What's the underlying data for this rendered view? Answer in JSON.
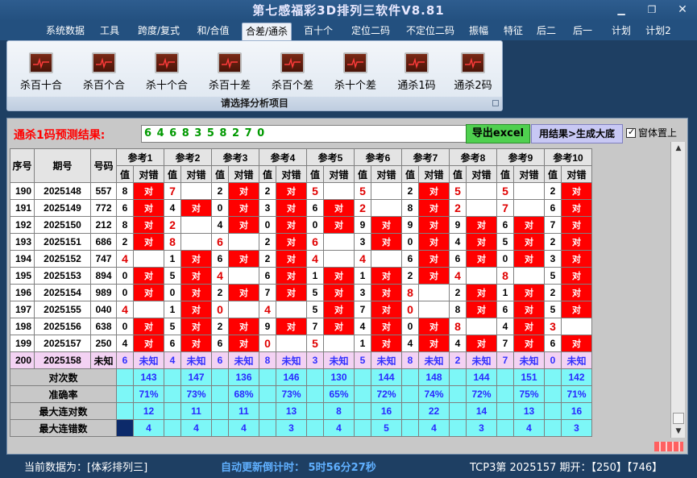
{
  "window": {
    "title": "第七感福彩3D排列三软件V8.81"
  },
  "menu": [
    "系统数据",
    "工具",
    "跨度/复式",
    "和/合值",
    "合差/通杀",
    "百十个",
    "定位二码",
    "不定位二码",
    "振幅",
    "特征",
    "后二",
    "后一",
    "计划",
    "计划2"
  ],
  "active_menu": "合差/通杀",
  "ribbon": {
    "buttons": [
      "杀百十合",
      "杀百个合",
      "杀十个合",
      "杀百十差",
      "杀百个差",
      "杀十个差",
      "通杀1码",
      "通杀2码"
    ],
    "group_label": "请选择分析项目"
  },
  "prediction": {
    "label": "通杀1码预测结果:",
    "value": "6 4 6 8 3 5 8 2 7 0",
    "export_button": "导出excel",
    "generate_button": "用结果>生成大底",
    "ontop_label": "窗体置上"
  },
  "table": {
    "headers": {
      "seq": "序号",
      "issue": "期号",
      "number": "号码",
      "value": "值",
      "hit": "对错"
    },
    "refs": [
      "参考1",
      "参考2",
      "参考3",
      "参考4",
      "参考5",
      "参考6",
      "参考7",
      "参考8",
      "参考9",
      "参考10"
    ],
    "hit_text": "对",
    "rows": [
      {
        "seq": "190",
        "issue": "2025148",
        "num": "557",
        "cells": [
          [
            "8",
            true
          ],
          [
            "7",
            false
          ],
          [
            "2",
            true
          ],
          [
            "2",
            true
          ],
          [
            "5",
            false
          ],
          [
            "5",
            false
          ],
          [
            "2",
            true
          ],
          [
            "5",
            false
          ],
          [
            "5",
            false
          ],
          [
            "2",
            true
          ]
        ]
      },
      {
        "seq": "191",
        "issue": "2025149",
        "num": "772",
        "cells": [
          [
            "6",
            true
          ],
          [
            "4",
            true
          ],
          [
            "0",
            true
          ],
          [
            "3",
            true
          ],
          [
            "6",
            true
          ],
          [
            "2",
            false
          ],
          [
            "8",
            true
          ],
          [
            "2",
            false
          ],
          [
            "7",
            false
          ],
          [
            "6",
            true
          ]
        ]
      },
      {
        "seq": "192",
        "issue": "2025150",
        "num": "212",
        "cells": [
          [
            "8",
            true
          ],
          [
            "2",
            false
          ],
          [
            "4",
            true
          ],
          [
            "0",
            true
          ],
          [
            "0",
            true
          ],
          [
            "9",
            true
          ],
          [
            "9",
            true
          ],
          [
            "9",
            true
          ],
          [
            "6",
            true
          ],
          [
            "7",
            true
          ]
        ]
      },
      {
        "seq": "193",
        "issue": "2025151",
        "num": "686",
        "cells": [
          [
            "2",
            true
          ],
          [
            "8",
            false
          ],
          [
            "6",
            false
          ],
          [
            "2",
            true
          ],
          [
            "6",
            false
          ],
          [
            "3",
            true
          ],
          [
            "0",
            true
          ],
          [
            "4",
            true
          ],
          [
            "5",
            true
          ],
          [
            "2",
            true
          ]
        ]
      },
      {
        "seq": "194",
        "issue": "2025152",
        "num": "747",
        "cells": [
          [
            "4",
            false
          ],
          [
            "1",
            true
          ],
          [
            "6",
            true
          ],
          [
            "2",
            true
          ],
          [
            "4",
            false
          ],
          [
            "4",
            false
          ],
          [
            "6",
            true
          ],
          [
            "6",
            true
          ],
          [
            "0",
            true
          ],
          [
            "3",
            true
          ]
        ]
      },
      {
        "seq": "195",
        "issue": "2025153",
        "num": "894",
        "cells": [
          [
            "0",
            true
          ],
          [
            "5",
            true
          ],
          [
            "4",
            false
          ],
          [
            "6",
            true
          ],
          [
            "1",
            true
          ],
          [
            "1",
            true
          ],
          [
            "2",
            true
          ],
          [
            "4",
            false
          ],
          [
            "8",
            false
          ],
          [
            "5",
            true
          ]
        ]
      },
      {
        "seq": "196",
        "issue": "2025154",
        "num": "989",
        "cells": [
          [
            "0",
            true
          ],
          [
            "0",
            true
          ],
          [
            "2",
            true
          ],
          [
            "7",
            true
          ],
          [
            "5",
            true
          ],
          [
            "3",
            true
          ],
          [
            "8",
            false
          ],
          [
            "2",
            true
          ],
          [
            "1",
            true
          ],
          [
            "2",
            true
          ]
        ]
      },
      {
        "seq": "197",
        "issue": "2025155",
        "num": "040",
        "cells": [
          [
            "4",
            false
          ],
          [
            "1",
            true
          ],
          [
            "0",
            false
          ],
          [
            "4",
            false
          ],
          [
            "5",
            true
          ],
          [
            "7",
            true
          ],
          [
            "0",
            false
          ],
          [
            "8",
            true
          ],
          [
            "6",
            true
          ],
          [
            "5",
            true
          ]
        ]
      },
      {
        "seq": "198",
        "issue": "2025156",
        "num": "638",
        "cells": [
          [
            "0",
            true
          ],
          [
            "5",
            true
          ],
          [
            "2",
            true
          ],
          [
            "9",
            true
          ],
          [
            "7",
            true
          ],
          [
            "4",
            true
          ],
          [
            "0",
            true
          ],
          [
            "8",
            false
          ],
          [
            "4",
            true
          ],
          [
            "3",
            false
          ]
        ]
      },
      {
        "seq": "199",
        "issue": "2025157",
        "num": "250",
        "cells": [
          [
            "4",
            true
          ],
          [
            "6",
            true
          ],
          [
            "6",
            true
          ],
          [
            "0",
            false
          ],
          [
            "5",
            false
          ],
          [
            "1",
            true
          ],
          [
            "4",
            true
          ],
          [
            "4",
            true
          ],
          [
            "7",
            true
          ],
          [
            "6",
            true
          ]
        ]
      }
    ],
    "prediction_row": {
      "seq": "200",
      "issue": "2025158",
      "num": "未知",
      "values": [
        "6",
        "4",
        "6",
        "8",
        "3",
        "5",
        "8",
        "2",
        "7",
        "0"
      ],
      "unknown": "未知"
    },
    "stats": [
      {
        "label": "对次数",
        "values": [
          "143",
          "147",
          "136",
          "146",
          "130",
          "144",
          "148",
          "144",
          "151",
          "142"
        ]
      },
      {
        "label": "准确率",
        "values": [
          "71%",
          "73%",
          "68%",
          "73%",
          "65%",
          "72%",
          "74%",
          "72%",
          "75%",
          "71%"
        ]
      },
      {
        "label": "最大连对数",
        "values": [
          "12",
          "11",
          "11",
          "13",
          "8",
          "16",
          "22",
          "14",
          "13",
          "16"
        ]
      },
      {
        "label": "最大连错数",
        "values": [
          "4",
          "4",
          "4",
          "3",
          "4",
          "5",
          "4",
          "3",
          "4",
          "3"
        ]
      }
    ]
  },
  "status": {
    "data_label": "当前数据为：[体彩排列三]",
    "countdown": "自动更新倒计时： 5时56分27秒",
    "issue_info": "TCP3第 2025157 期开：【250】【746】"
  },
  "colors": {
    "hit": "#ff0000",
    "stat_bg": "#7df7f7",
    "prediction_bg": "#f3d2f3",
    "accent_green": "#4fd04f"
  }
}
